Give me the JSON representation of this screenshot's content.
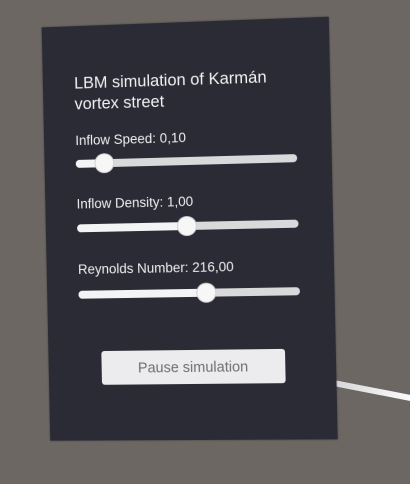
{
  "panel": {
    "title": "LBM simulation of Karmán vortex street"
  },
  "controls": {
    "inflow_speed": {
      "label": "Inflow Speed: 0,10",
      "value_fraction": 0.13
    },
    "inflow_density": {
      "label": "Inflow Density: 1,00",
      "value_fraction": 0.5
    },
    "reynolds_number": {
      "label": "Reynolds Number: 216,00",
      "value_fraction": 0.58
    }
  },
  "actions": {
    "pause_label": "Pause simulation"
  },
  "colors": {
    "panel_background": "#2b2b35",
    "scene_background": "#6c6762",
    "slider_track": "#d9d9dc",
    "button_background": "#ececee"
  }
}
